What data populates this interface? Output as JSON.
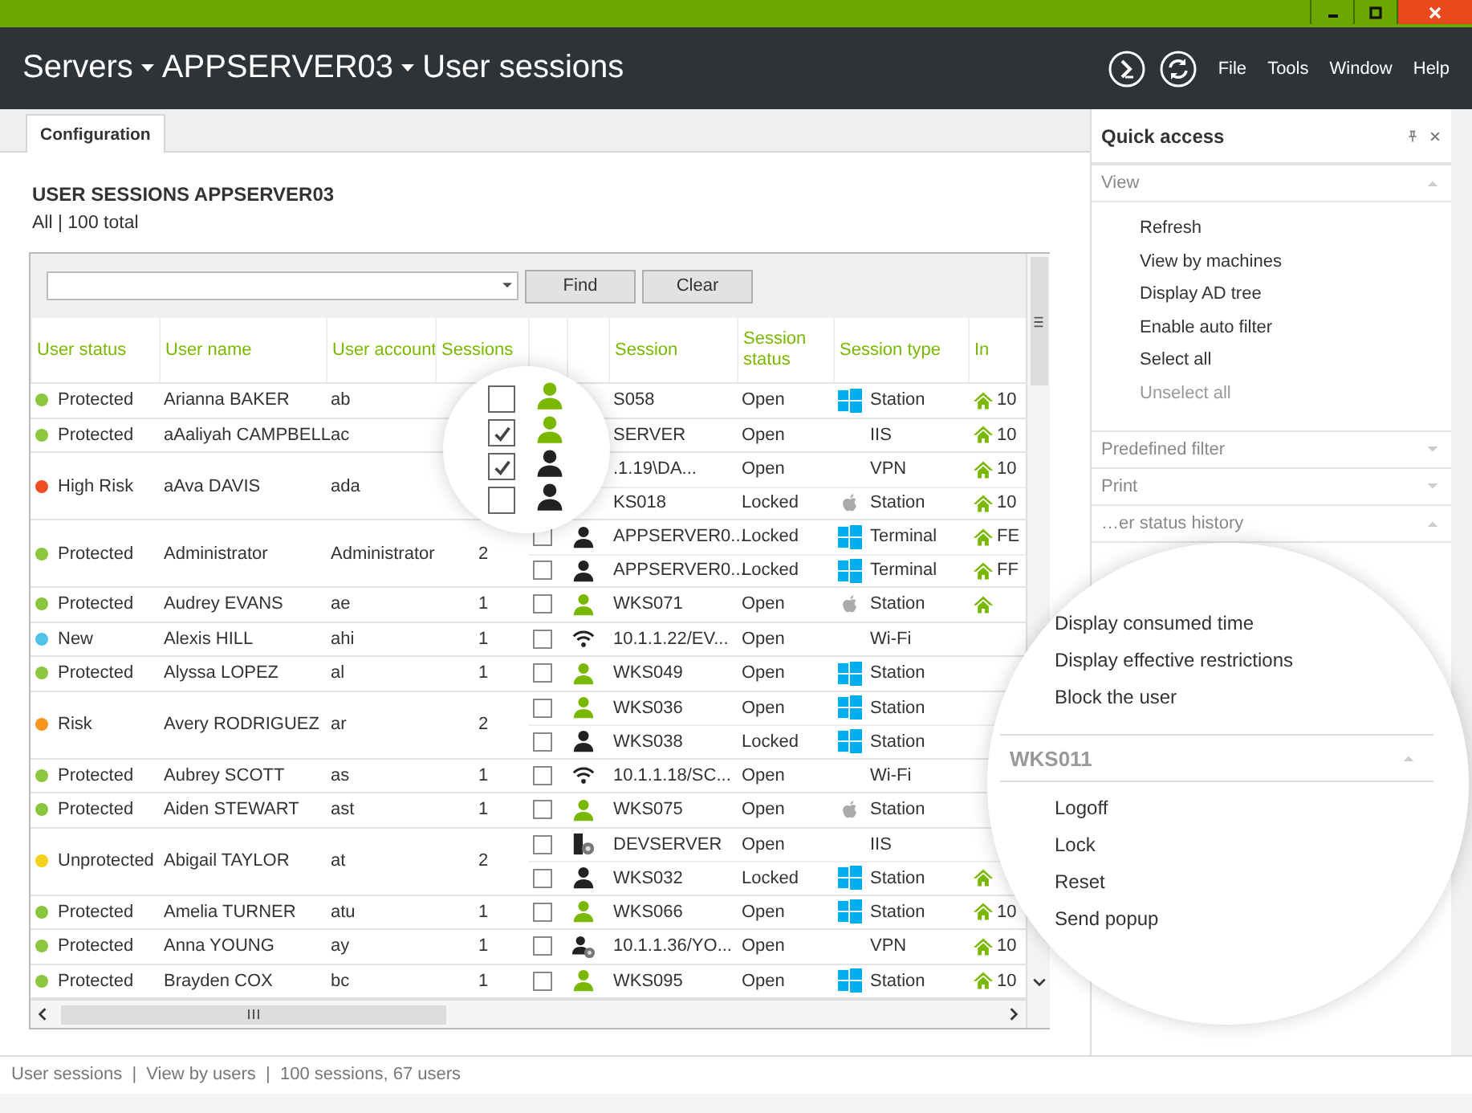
{
  "window": {
    "breadcrumbs": [
      "Servers",
      "APPSERVER03",
      "User sessions"
    ],
    "menu": [
      "File",
      "Tools",
      "Window",
      "Help"
    ]
  },
  "tabs": [
    {
      "label": "Configuration",
      "selected": true
    }
  ],
  "heading": "USER SESSIONS APPSERVER03",
  "subheading": "All | 100 total",
  "filter": {
    "buttons": [
      "Find",
      "Clear"
    ]
  },
  "table": {
    "columns": [
      "User status",
      "User name",
      "User account",
      "Sessions",
      "Session",
      "Session status",
      "Session type",
      "In"
    ],
    "rows": [
      {
        "status": "Protected",
        "color": "#8cc63f",
        "name": "Arianna BAKER",
        "account": "ab",
        "sessions": [
          {
            "in_lens": true,
            "checked": false,
            "kind": "user-open",
            "name": "S058",
            "status": "Open",
            "type": {
              "kind": "windows",
              "label": "Station"
            },
            "home": true,
            "ip": "10"
          }
        ]
      },
      {
        "status": "Protected",
        "color": "#8cc63f",
        "name": "aAaliyah CAMPBELL",
        "account": "ac",
        "sessions": [
          {
            "in_lens": true,
            "checked": true,
            "kind": "user-open",
            "name": "SERVER",
            "status": "Open",
            "type": {
              "label": "IIS"
            },
            "home": true,
            "ip": "10"
          }
        ]
      },
      {
        "status": "High Risk",
        "color": "#f04e23",
        "name": "aAva DAVIS",
        "account": "ada",
        "sessions": [
          {
            "in_lens": true,
            "checked": true,
            "kind": "user-locked",
            "name": ".1.19\\DA...",
            "status": "Open",
            "type": {
              "label": "VPN"
            },
            "home": true,
            "ip": "10"
          },
          {
            "in_lens": true,
            "checked": false,
            "kind": "user-locked",
            "name": "KS018",
            "status": "Locked",
            "type": {
              "kind": "apple",
              "label": "Station"
            },
            "home": true,
            "ip": "10"
          }
        ]
      },
      {
        "status": "Protected",
        "color": "#8cc63f",
        "name": "Administrator",
        "account": "Administrator",
        "count": "2",
        "sessions": [
          {
            "in_lens": false,
            "checked": false,
            "kind": "user-locked",
            "name": "APPSERVER0...",
            "status": "Locked",
            "type": {
              "kind": "windows",
              "label": "Terminal"
            },
            "home": true,
            "ip": "FE"
          },
          {
            "in_lens": false,
            "checked": false,
            "kind": "user-locked",
            "name": "APPSERVER0...",
            "status": "Locked",
            "type": {
              "kind": "windows",
              "label": "Terminal"
            },
            "home": true,
            "ip": "FF"
          }
        ]
      },
      {
        "status": "Protected",
        "color": "#8cc63f",
        "name": "Audrey EVANS",
        "account": "ae",
        "count": "1",
        "sessions": [
          {
            "in_lens": false,
            "checked": false,
            "kind": "user-open",
            "name": "WKS071",
            "status": "Open",
            "type": {
              "kind": "apple",
              "label": "Station"
            },
            "home": true
          }
        ]
      },
      {
        "status": "New",
        "color": "#4fc3e8",
        "name": "Alexis HILL",
        "account": "ahi",
        "count": "1",
        "sessions": [
          {
            "in_lens": false,
            "checked": false,
            "kind": "wifi",
            "name": "10.1.1.22/EV...",
            "status": "Open",
            "type": {
              "label": "Wi-Fi"
            },
            "home": false
          }
        ]
      },
      {
        "status": "Protected",
        "color": "#8cc63f",
        "name": "Alyssa LOPEZ",
        "account": "al",
        "count": "1",
        "sessions": [
          {
            "in_lens": false,
            "checked": false,
            "kind": "user-open",
            "name": "WKS049",
            "status": "Open",
            "type": {
              "kind": "windows",
              "label": "Station"
            },
            "home": false
          }
        ]
      },
      {
        "status": "Risk",
        "color": "#f7941d",
        "name": "Avery RODRIGUEZ",
        "account": "ar",
        "count": "2",
        "sessions": [
          {
            "in_lens": false,
            "checked": false,
            "kind": "user-open",
            "name": "WKS036",
            "status": "Open",
            "type": {
              "kind": "windows",
              "label": "Station"
            },
            "home": false
          },
          {
            "in_lens": false,
            "checked": false,
            "kind": "user-locked",
            "name": "WKS038",
            "status": "Locked",
            "type": {
              "kind": "windows",
              "label": "Station"
            },
            "home": false
          }
        ]
      },
      {
        "status": "Protected",
        "color": "#8cc63f",
        "name": "Aubrey SCOTT",
        "account": "as",
        "count": "1",
        "sessions": [
          {
            "in_lens": false,
            "checked": false,
            "kind": "wifi",
            "name": "10.1.1.18/SC...",
            "status": "Open",
            "type": {
              "label": "Wi-Fi"
            },
            "home": false
          }
        ]
      },
      {
        "status": "Protected",
        "color": "#8cc63f",
        "name": "Aiden STEWART",
        "account": "ast",
        "count": "1",
        "sessions": [
          {
            "in_lens": false,
            "checked": false,
            "kind": "user-open",
            "name": "WKS075",
            "status": "Open",
            "type": {
              "kind": "apple",
              "label": "Station"
            },
            "home": false
          }
        ]
      },
      {
        "status": "Unprotected",
        "color": "#f2d21b",
        "name": "Abigail TAYLOR",
        "account": "at",
        "count": "2",
        "sessions": [
          {
            "in_lens": false,
            "checked": false,
            "kind": "server",
            "name": "DEVSERVER",
            "status": "Open",
            "type": {
              "label": "IIS"
            },
            "home": false
          },
          {
            "in_lens": false,
            "checked": false,
            "kind": "user-locked",
            "name": "WKS032",
            "status": "Locked",
            "type": {
              "kind": "windows",
              "label": "Station"
            },
            "home": true
          }
        ]
      },
      {
        "status": "Protected",
        "color": "#8cc63f",
        "name": "Amelia TURNER",
        "account": "atu",
        "count": "1",
        "sessions": [
          {
            "in_lens": false,
            "checked": false,
            "kind": "user-open",
            "name": "WKS066",
            "status": "Open",
            "type": {
              "kind": "windows",
              "label": "Station"
            },
            "home": true,
            "ip": "10"
          }
        ]
      },
      {
        "status": "Protected",
        "color": "#8cc63f",
        "name": "Anna YOUNG",
        "account": "ay",
        "count": "1",
        "sessions": [
          {
            "in_lens": false,
            "checked": false,
            "kind": "user-gear",
            "name": "10.1.1.36/YO...",
            "status": "Open",
            "type": {
              "label": "VPN"
            },
            "home": true,
            "ip": "10"
          }
        ]
      },
      {
        "status": "Protected",
        "color": "#8cc63f",
        "name": "Brayden COX",
        "account": "bc",
        "count": "1",
        "sessions": [
          {
            "in_lens": false,
            "checked": false,
            "kind": "user-open",
            "name": "WKS095",
            "status": "Open",
            "type": {
              "kind": "windows",
              "label": "Station"
            },
            "home": true,
            "ip": "10"
          }
        ]
      }
    ]
  },
  "panel": {
    "title": "Quick access",
    "sections": [
      {
        "title": "View",
        "expanded": true,
        "items": [
          {
            "label": "Refresh",
            "disabled": false
          },
          {
            "label": "View by machines",
            "disabled": false
          },
          {
            "label": "Display AD tree",
            "disabled": false
          },
          {
            "label": "Enable auto filter",
            "disabled": false
          },
          {
            "label": "Select all",
            "disabled": false
          },
          {
            "label": "Unselect all",
            "disabled": true
          }
        ]
      },
      {
        "title": "Predefined filter",
        "expanded": false
      },
      {
        "title": "Print",
        "expanded": false
      },
      {
        "title": "…er status history",
        "expanded": true
      }
    ]
  },
  "lens": {
    "items": [
      "Display consumed time",
      "Display effective restrictions",
      "Block the user"
    ],
    "section": {
      "title": "WKS011",
      "expanded": true,
      "items": [
        "Logoff",
        "Lock",
        "Reset",
        "Send popup"
      ]
    }
  },
  "status_bar": "User sessions  |  View by users  |  100 sessions, 67 users"
}
